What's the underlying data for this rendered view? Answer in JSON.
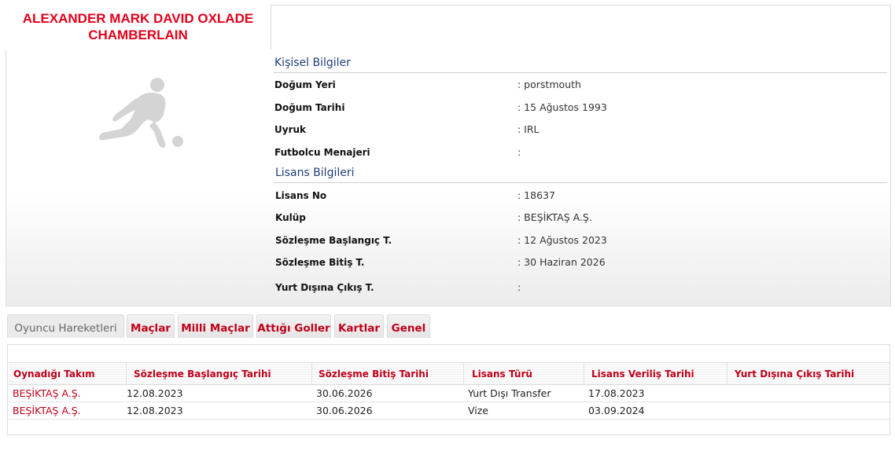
{
  "player": {
    "name_line1": "ALEXANDER MARK DAVID OXLADE",
    "name_line2": "CHAMBERLAIN"
  },
  "personal": {
    "title": "Kişisel Bilgiler",
    "rows": [
      {
        "label": "Doğum Yeri",
        "value": ":  porstmouth"
      },
      {
        "label": "Doğum Tarihi",
        "value": ":  15 Ağustos 1993"
      },
      {
        "label": "Uyruk",
        "value": ":  IRL"
      },
      {
        "label": "Futbolcu Menajeri",
        "value": ":"
      }
    ]
  },
  "license": {
    "title": "Lisans Bilgileri",
    "rows": [
      {
        "label": "Lisans No",
        "value": ": 18637"
      },
      {
        "label": "Kulüp",
        "value": ": BEŞİKTAŞ A.Ş."
      },
      {
        "label": "Sözleşme Başlangıç T.",
        "value": ": 12 Ağustos 2023"
      },
      {
        "label": "Sözleşme Bitiş T.",
        "value": ": 30 Haziran 2026"
      },
      {
        "label": "Yurt Dışına Çıkış T.",
        "value": ":"
      }
    ]
  },
  "tabs": [
    {
      "label": "Oyuncu Hareketleri",
      "active": true
    },
    {
      "label": "Maçlar"
    },
    {
      "label": "Milli Maçlar"
    },
    {
      "label": "Attığı Goller"
    },
    {
      "label": "Kartlar"
    },
    {
      "label": "Genel"
    }
  ],
  "table": {
    "headers": [
      "Oynadığı Takım",
      "Sözleşme Başlangıç Tarihi",
      "Sözleşme Bitiş Tarihi",
      "Lisans Türü",
      "Lisans Veriliş Tarihi",
      "Yurt Dışına Çıkış Tarihi"
    ],
    "rows": [
      [
        "BEŞİKTAŞ A.Ş.",
        "12.08.2023",
        "30.06.2026",
        "Yurt Dışı Transfer",
        "17.08.2023",
        ""
      ],
      [
        "BEŞİKTAŞ A.Ş.",
        "12.08.2023",
        "30.06.2026",
        "Vize",
        "03.09.2024",
        ""
      ]
    ]
  },
  "icons": {
    "player_photo": "player-silhouette-icon"
  },
  "colors": {
    "accent_red": "#e3001b",
    "tab_red": "#c0001a",
    "section_blue": "#1e3d78"
  }
}
